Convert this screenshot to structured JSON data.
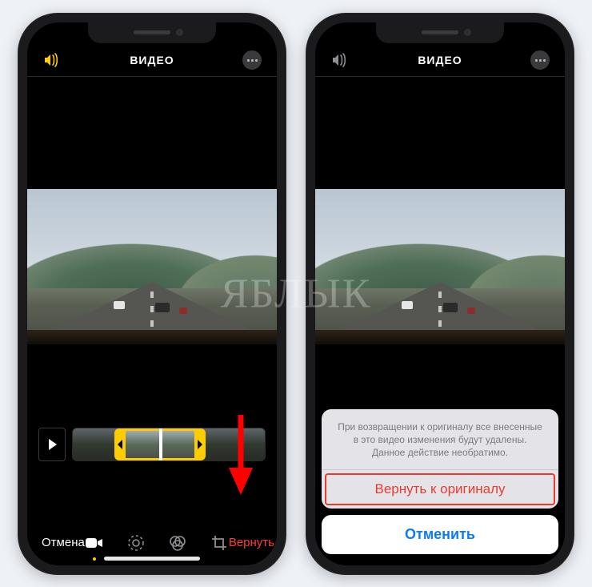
{
  "watermark": "ЯБЛЫК",
  "left": {
    "header": {
      "title": "ВИДЕО"
    },
    "toolbar": {
      "cancel": "Отмена",
      "revert": "Вернуть"
    },
    "icons": {
      "sound": "sound-icon",
      "more": "more-icon",
      "play": "play-icon",
      "video": "video-tool-icon",
      "adjust": "adjust-tool-icon",
      "filters": "filters-tool-icon",
      "crop": "crop-tool-icon"
    }
  },
  "right": {
    "header": {
      "title": "ВИДЕО"
    },
    "sheet": {
      "message": "При возвращении к оригиналу все внесенные в это видео изменения будут удалены. Данное действие необратимо.",
      "revert": "Вернуть к оригиналу",
      "cancel": "Отменить"
    },
    "icons": {
      "sound": "sound-icon",
      "more": "more-icon"
    }
  }
}
